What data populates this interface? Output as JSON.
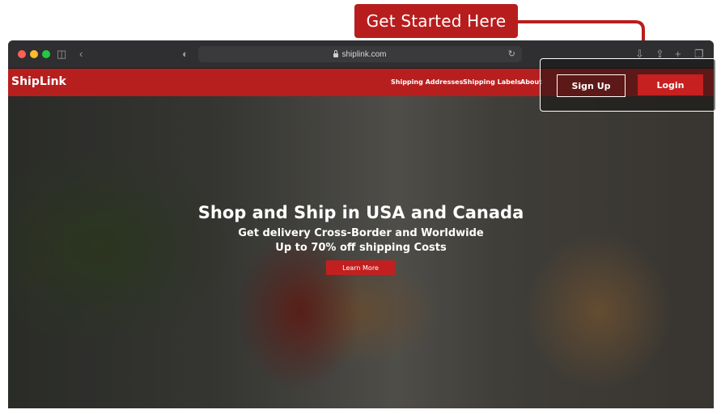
{
  "callout": {
    "text": "Get Started Here"
  },
  "browser": {
    "address": "shiplink.com",
    "icons": [
      "sidebar-icon",
      "back-icon",
      "shield-icon",
      "reload-icon",
      "download-icon",
      "share-icon",
      "new-tab-icon",
      "tabs-icon"
    ]
  },
  "site": {
    "brand": "ShipLink",
    "nav": [
      {
        "label": "Shipping Addresses"
      },
      {
        "label": "Shipping Labels"
      },
      {
        "label": "About"
      }
    ],
    "auth": {
      "signup": "Sign Up",
      "login": "Login"
    }
  },
  "hero": {
    "title": "Shop and Ship in USA and Canada",
    "subtitle1": "Get delivery Cross-Border and Worldwide",
    "subtitle2": "Up to 70% off shipping Costs",
    "cta": "Learn More"
  },
  "colors": {
    "brand_red": "#b71f1f",
    "button_red": "#c62020",
    "callout_red": "#b81d1d"
  }
}
